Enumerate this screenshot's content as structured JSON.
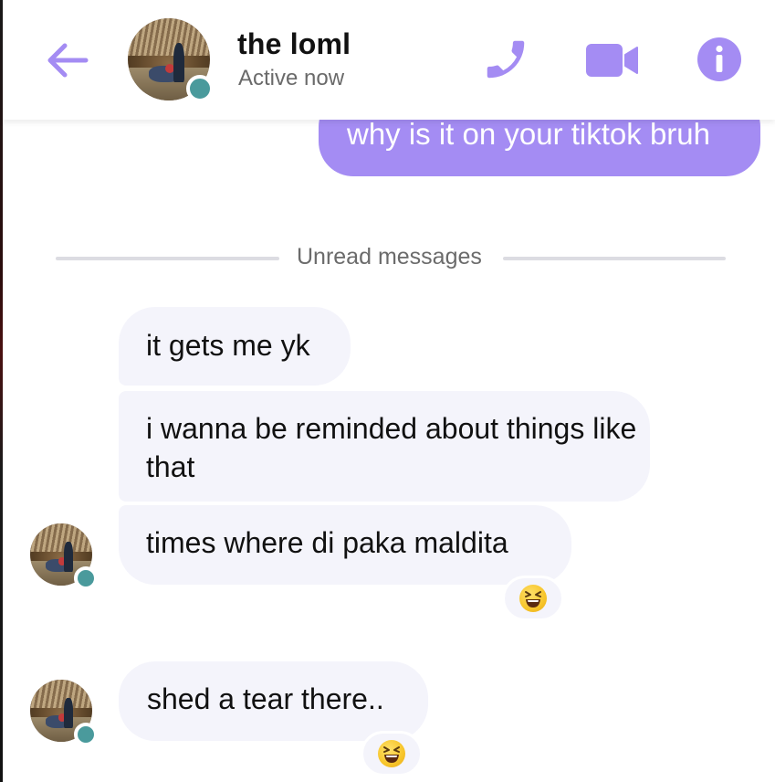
{
  "header": {
    "contact_name": "the loml",
    "status": "Active now",
    "back_icon": "arrow-left-icon",
    "call_icon": "phone-icon",
    "video_icon": "video-camera-icon",
    "info_icon": "info-icon",
    "accent_color": "#a48cf3",
    "online_color": "#4a9a9c"
  },
  "messages": {
    "outgoing": [
      {
        "text": "why is it on your tiktok bruh"
      }
    ],
    "divider_label": "Unread messages",
    "incoming": [
      {
        "text": "it gets me yk"
      },
      {
        "text": "i wanna be reminded about things like that"
      },
      {
        "text": "times where di paka maldita",
        "reaction": "laughing-squinting-emoji"
      },
      {
        "text": "shed a tear there..",
        "reaction": "laughing-squinting-emoji"
      }
    ]
  },
  "colors": {
    "outgoing_bubble": "#a48cf3",
    "incoming_bubble": "#f4f4fb",
    "divider_line": "#dcdce2"
  }
}
